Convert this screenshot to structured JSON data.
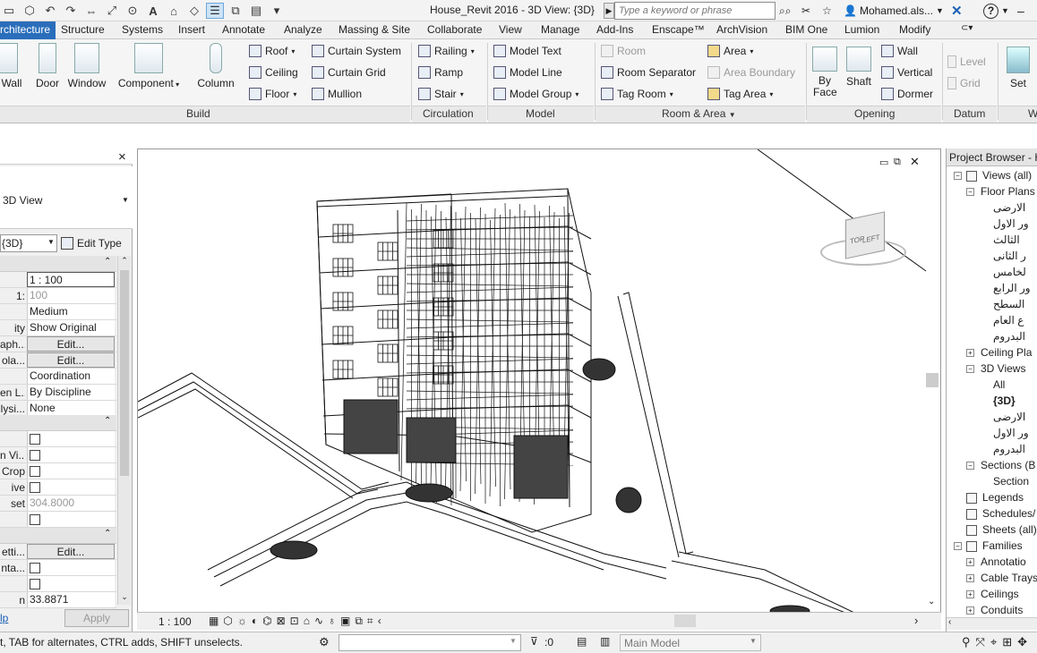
{
  "titlebar": {
    "title": "House_Revit 2016 - 3D View: {3D}",
    "search_placeholder": "Type a keyword or phrase",
    "user": "Mohamed.als...",
    "help": "?"
  },
  "tabs": [
    "rchitecture",
    "Structure",
    "Systems",
    "Insert",
    "Annotate",
    "Analyze",
    "Massing & Site",
    "Collaborate",
    "View",
    "Manage",
    "Add-Ins",
    "Enscape™",
    "ArchVision",
    "BIM One",
    "Lumion",
    "Modify"
  ],
  "ribbon": {
    "build": {
      "title": "Build",
      "big": [
        "Wall",
        "Door",
        "Window",
        "Component",
        "Column"
      ],
      "small": [
        "Roof",
        "Ceiling",
        "Floor",
        "Curtain System",
        "Curtain Grid",
        "Mullion"
      ]
    },
    "circulation": {
      "title": "Circulation",
      "items": [
        "Railing",
        "Ramp",
        "Stair"
      ]
    },
    "model": {
      "title": "Model",
      "items": [
        "Model Text",
        "Model Line",
        "Model Group"
      ]
    },
    "room_area": {
      "title": "Room & Area",
      "items": [
        "Room",
        "Room Separator",
        "Tag Room",
        "Area",
        "Area Boundary",
        "Tag Area"
      ]
    },
    "opening": {
      "title": "Opening",
      "big": [
        "By Face",
        "Shaft"
      ],
      "items": [
        "Wall",
        "Vertical",
        "Dormer"
      ]
    },
    "datum": {
      "title": "Datum",
      "items": [
        "Level",
        "Grid"
      ]
    },
    "work_plane": {
      "title": "W",
      "big": [
        "Set"
      ]
    }
  },
  "properties": {
    "close": "×",
    "type_name": "3D View",
    "selector": "{3D}",
    "edit_type": "Edit Type",
    "rows": [
      {
        "k": "",
        "v": "1 : 100"
      },
      {
        "k": "1:",
        "v": "100"
      },
      {
        "k": "",
        "v": "Medium"
      },
      {
        "k": "ity",
        "v": "Show Original"
      },
      {
        "k": "aph...",
        "v": "Edit..."
      },
      {
        "k": "ola...",
        "v": "Edit..."
      },
      {
        "k": "",
        "v": "Coordination"
      },
      {
        "k": "en L...",
        "v": "By Discipline"
      },
      {
        "k": "lysi...",
        "v": "None"
      }
    ],
    "rows2": [
      {
        "k": ""
      },
      {
        "k": "n Vi..."
      },
      {
        "k": "Crop"
      },
      {
        "k": "ive"
      },
      {
        "k": "set",
        "v": "304.8000"
      },
      {
        "k": ""
      }
    ],
    "rows3": [
      {
        "k": "etti...",
        "v": "Edit..."
      },
      {
        "k": "nta..."
      },
      {
        "k": ""
      },
      {
        "k": "n",
        "v": "33.8871"
      }
    ],
    "help": "lp",
    "apply": "Apply"
  },
  "viewport": {
    "scale": "1 : 100",
    "viewcube_left": "LEFT",
    "viewcube_top": "TOP"
  },
  "browser": {
    "title": "Project Browser - H",
    "nodes": [
      "Views (all)",
      "Floor Plans",
      "الارضى",
      "ور الاول",
      "الثالث",
      "ر الثانى",
      "لخامس",
      "ور الرابع",
      "السطح",
      "ع العام",
      "البدروم",
      "Ceiling Pla",
      "3D Views",
      "All",
      "{3D}",
      "الارضى",
      "ور الاول",
      "البدروم",
      "Sections (B",
      "Section",
      "Legends",
      "Schedules/",
      "Sheets (all)",
      "Families",
      "Annotatio",
      "Cable Trays",
      "Ceilings",
      "Conduits"
    ]
  },
  "status": {
    "hint": "t, TAB for alternates, CTRL adds, SHIFT unselects.",
    "filter_count": ":0",
    "model": "Main Model"
  }
}
